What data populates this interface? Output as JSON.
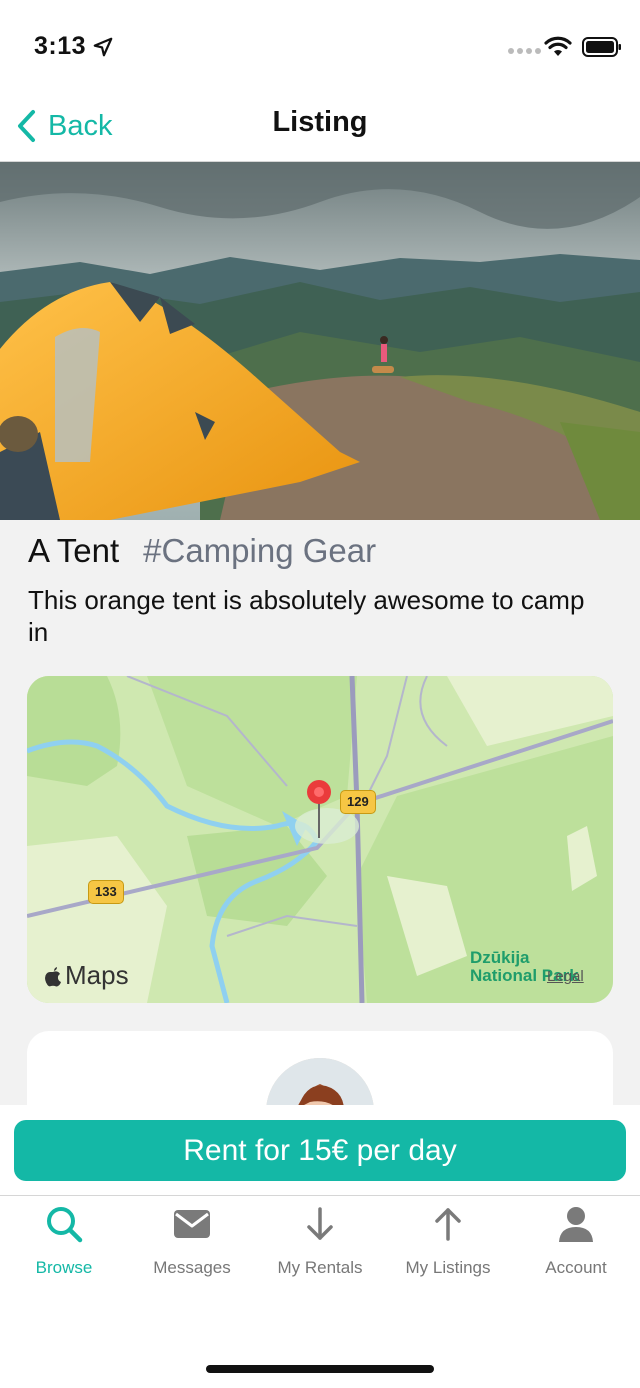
{
  "status_bar": {
    "time": "3:13"
  },
  "nav": {
    "back_label": "Back",
    "title": "Listing"
  },
  "listing": {
    "title": "A Tent",
    "category": "#Camping Gear",
    "description": "This orange tent is absolutely awesome to camp in"
  },
  "map": {
    "brand": "Maps",
    "route_labels": [
      "129",
      "133"
    ],
    "park_name": "Dzūkija National Park",
    "legal": "Legal"
  },
  "rent_button": {
    "label": "Rent for 15€ per day"
  },
  "tabs": [
    {
      "label": "Browse",
      "icon": "search-icon",
      "active": true
    },
    {
      "label": "Messages",
      "icon": "envelope-icon",
      "active": false
    },
    {
      "label": "My Rentals",
      "icon": "arrow-down-icon",
      "active": false
    },
    {
      "label": "My Listings",
      "icon": "arrow-up-icon",
      "active": false
    },
    {
      "label": "Account",
      "icon": "person-icon",
      "active": false
    }
  ],
  "colors": {
    "accent": "#14b8a6",
    "tent": "#f5a623",
    "map_land": "#cfe8b0"
  }
}
